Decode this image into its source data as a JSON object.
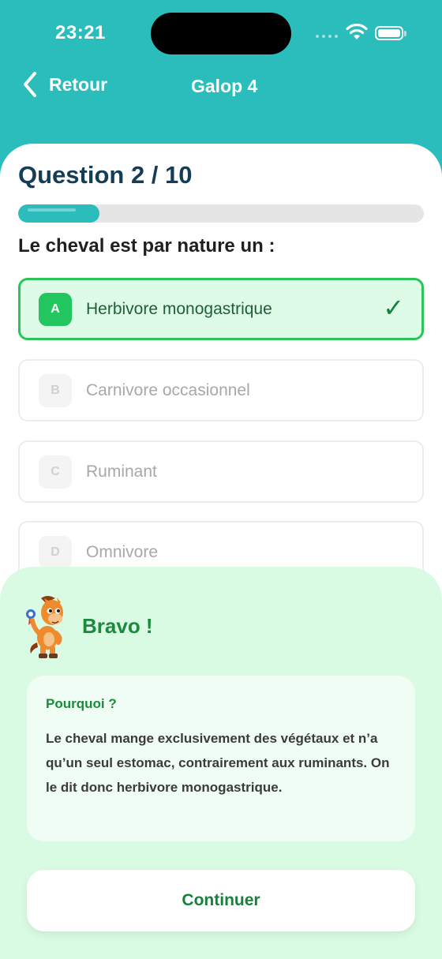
{
  "status_bar": {
    "time": "23:21",
    "icons": [
      "cellular-signal-icon",
      "wifi-icon",
      "battery-icon"
    ]
  },
  "nav": {
    "back_label": "Retour",
    "title": "Galop 4"
  },
  "quiz": {
    "header": "Question 2 / 10",
    "progress": 0.2,
    "question": "Le cheval est par nature un :",
    "options": [
      {
        "letter": "A",
        "label": "Herbivore monogastrique",
        "state": "correct"
      },
      {
        "letter": "B",
        "label": "Carnivore occasionnel",
        "state": "dimmed"
      },
      {
        "letter": "C",
        "label": "Ruminant",
        "state": "dimmed"
      },
      {
        "letter": "D",
        "label": "Omnivore",
        "state": "dimmed"
      }
    ]
  },
  "feedback": {
    "title": "Bravo !",
    "why_title": "Pourquoi ?",
    "explanation": "Le cheval mange exclusivement des végétaux et n’a qu’un seul estomac, contrairement aux ruminants. On le dit donc herbivore monogastrique.",
    "continue_label": "Continuer"
  },
  "colors": {
    "header_bg": "#2bbcbc",
    "title_dark": "#143d57",
    "correct_green": "#22c55e",
    "correct_bg": "#ddfbe6",
    "feedback_bg": "#dafbe3",
    "text_green": "#1b8a3d"
  }
}
